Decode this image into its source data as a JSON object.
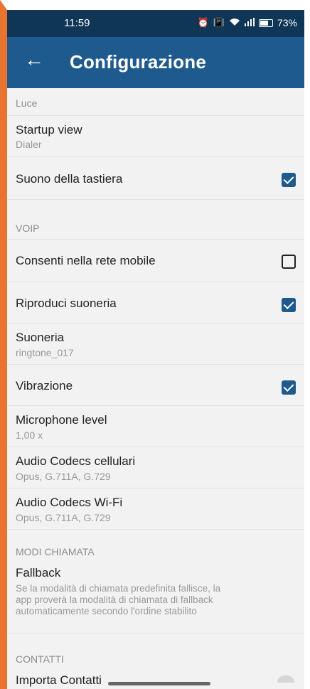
{
  "status_bar": {
    "time": "11:59",
    "battery": "73%",
    "icons": [
      "alarm-icon",
      "vibrate-icon",
      "wifi-icon",
      "signal-icon",
      "battery-icon"
    ]
  },
  "app_bar": {
    "title": "Configurazione"
  },
  "sections": {
    "luce": "Luce",
    "voip": "VOIP",
    "modi": "MODI CHIAMATA",
    "contatti": "CONTATTI"
  },
  "items": {
    "startup": {
      "title": "Startup view",
      "subtitle": "Dialer"
    },
    "suono": {
      "title": "Suono della tastiera",
      "checked": true
    },
    "consenti": {
      "title": "Consenti nella rete mobile",
      "checked": false
    },
    "riproduci": {
      "title": "Riproduci suoneria",
      "checked": true
    },
    "suoneria": {
      "title": "Suoneria",
      "subtitle": "ringtone_017"
    },
    "vibrazione": {
      "title": "Vibrazione",
      "checked": true
    },
    "mic": {
      "title": "Microphone level",
      "subtitle": "1,00 x"
    },
    "codec_cell": {
      "title": "Audio Codecs cellulari",
      "subtitle": "Opus, G.711A, G.729"
    },
    "codec_wifi": {
      "title": "Audio Codecs Wi-Fi",
      "subtitle": "Opus, G.711A, G.729"
    },
    "fallback": {
      "title": "Fallback",
      "description_lines": [
        "Se la modalità di chiamata predefinita fallisce, la",
        "app proverà la modalità di chiamata di fallback",
        "automaticamente secondo l'ordine stabilito"
      ]
    },
    "importa": {
      "title": "Importa Contatti"
    }
  },
  "colors": {
    "status_bar": "#0f3557",
    "app_bar": "#1f5a8f",
    "accent_checkbox": "#1f5a8f",
    "frame_border": "#e8742f"
  }
}
